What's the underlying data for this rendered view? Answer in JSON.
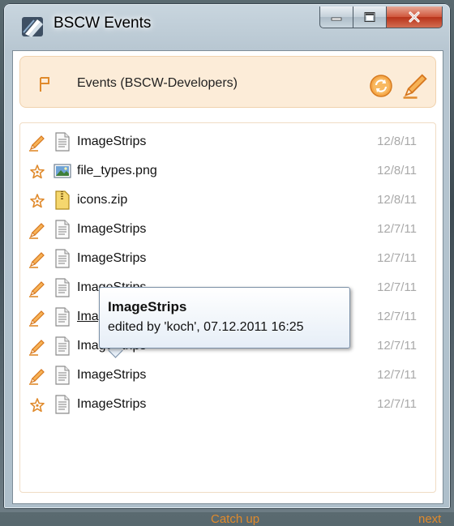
{
  "window": {
    "title": "BSCW Events",
    "accent": "#e08a2c"
  },
  "header": {
    "title": "Events (BSCW-Developers)"
  },
  "rows": [
    {
      "event": "edit-icon",
      "file": "text-file-icon",
      "name": "ImageStrips",
      "date": "12/8/11"
    },
    {
      "event": "new-icon",
      "file": "image-file-icon",
      "name": "file_types.png",
      "date": "12/8/11"
    },
    {
      "event": "new-icon",
      "file": "zip-file-icon",
      "name": "icons.zip",
      "date": "12/8/11"
    },
    {
      "event": "edit-icon",
      "file": "text-file-icon",
      "name": "ImageStrips",
      "date": "12/7/11"
    },
    {
      "event": "edit-icon",
      "file": "text-file-icon",
      "name": "ImageStrips",
      "date": "12/7/11"
    },
    {
      "event": "edit-icon",
      "file": "text-file-icon",
      "name": "ImageStrips",
      "date": "12/7/11"
    },
    {
      "event": "edit-icon",
      "file": "text-file-icon",
      "name": "ImageStrips",
      "date": "12/7/11"
    },
    {
      "event": "edit-icon",
      "file": "text-file-icon",
      "name": "ImageStrips",
      "date": "12/7/11"
    },
    {
      "event": "edit-icon",
      "file": "text-file-icon",
      "name": "ImageStrips",
      "date": "12/7/11"
    },
    {
      "event": "new-icon",
      "file": "text-file-icon",
      "name": "ImageStrips",
      "date": "12/7/11"
    }
  ],
  "footer": {
    "catch_up": "Catch up",
    "next": "next"
  },
  "tooltip": {
    "title": "ImageStrips",
    "detail": "edited by 'koch', 07.12.2011 16:25"
  }
}
